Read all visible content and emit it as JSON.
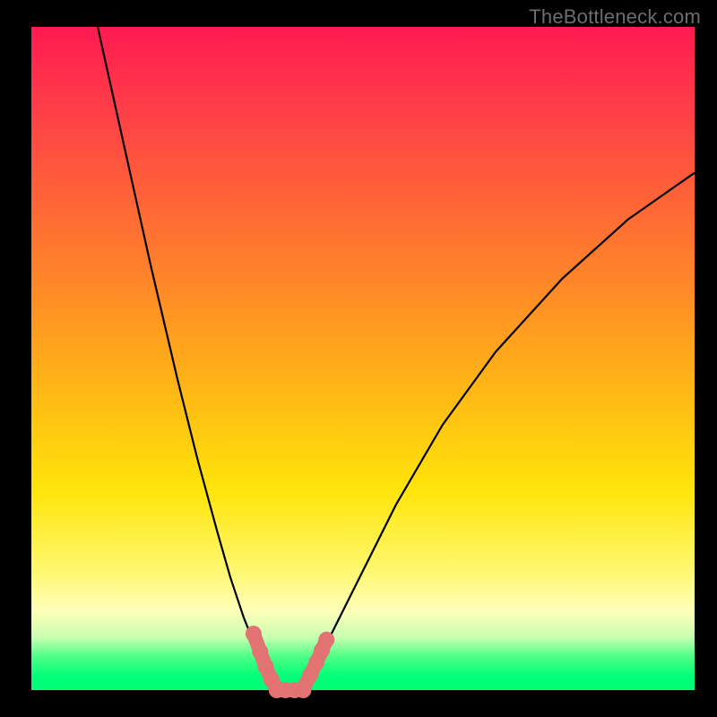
{
  "watermark": "TheBottleneck.com",
  "chart_data": {
    "type": "line",
    "title": "",
    "xlabel": "",
    "ylabel": "",
    "xlim": [
      0,
      100
    ],
    "ylim": [
      0,
      100
    ],
    "series": [
      {
        "name": "left-curve",
        "x": [
          10,
          14,
          18,
          22,
          25,
          28,
          30,
          32,
          34,
          35.5,
          37
        ],
        "y": [
          100,
          82,
          64,
          47,
          35,
          24,
          17,
          11,
          6,
          3,
          0
        ]
      },
      {
        "name": "right-curve",
        "x": [
          41,
          43,
          46,
          50,
          55,
          62,
          70,
          80,
          90,
          100
        ],
        "y": [
          0,
          4,
          10,
          18,
          28,
          40,
          51,
          62,
          71,
          78
        ]
      },
      {
        "name": "highlight-left",
        "x": [
          33.5,
          34.5,
          35.3,
          36.2,
          37
        ],
        "y": [
          8.5,
          5.8,
          3.6,
          1.6,
          0.2
        ]
      },
      {
        "name": "highlight-bottom",
        "x": [
          37,
          38.3,
          39.7,
          41
        ],
        "y": [
          0,
          0,
          0,
          0
        ]
      },
      {
        "name": "highlight-right",
        "x": [
          41,
          42,
          43,
          43.8,
          44.5
        ],
        "y": [
          0.2,
          2.2,
          4.2,
          6.0,
          7.6
        ]
      }
    ],
    "colors": {
      "curve": "#000000",
      "highlight": "#e27373",
      "gradient_top": "#ff1a50",
      "gradient_mid": "#ffe50b",
      "gradient_bottom": "#00ff78"
    }
  }
}
